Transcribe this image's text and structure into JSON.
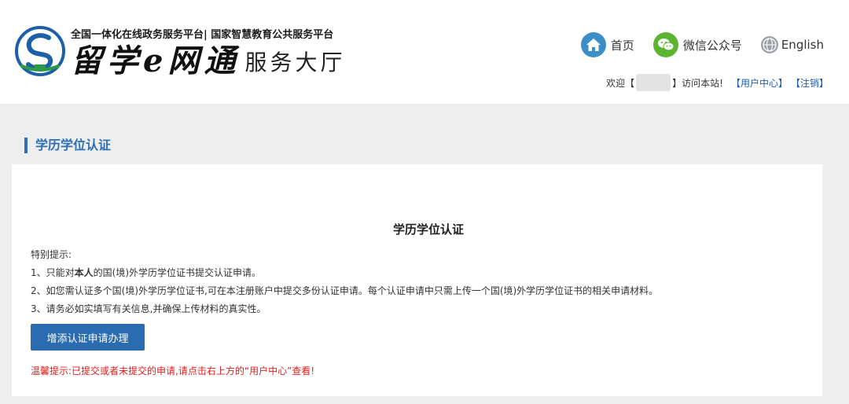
{
  "header": {
    "platform_line": "全国一体化在线政务服务平台| 国家智慧教育公共服务平台",
    "brand_art": "留学e网通",
    "brand_service": "服务大厅"
  },
  "nav": {
    "home": "首页",
    "wechat": "微信公众号",
    "english": "English"
  },
  "welcome": {
    "prefix": "欢迎【",
    "suffix": "】访问本站!",
    "user_center": "【用户中心】",
    "logout": "【注销】"
  },
  "section": {
    "title": "学历学位认证"
  },
  "panel": {
    "title": "学历学位认证",
    "notice_heading": "特别提示:",
    "notice_1a": "1、只能对",
    "notice_1b": "本人",
    "notice_1c": "的国(境)外学历学位证书提交认证申请。",
    "notice_2": "2、如您需认证多个国(境)外学历学位证书,可在本注册账户中提交多份认证申请。每个认证申请中只需上传一个国(境)外学历学位证书的相关申请材料。",
    "notice_3": "3、请务必如实填写有关信息,并确保上传材料的真实性。",
    "add_button": "增添认证申请办理",
    "warm_tip": "温馨提示:已提交或者未提交的申请,请点击右上方的“用户中心”查看!"
  },
  "colors": {
    "accent": "#2c6fb3",
    "button": "#2b6cb0",
    "warning": "#e02020",
    "wechat": "#5cb531",
    "home": "#3c8fc6"
  },
  "icons": {
    "logo": "logo-emblem-icon",
    "home": "home-icon",
    "wechat": "wechat-icon",
    "globe": "globe-icon"
  }
}
